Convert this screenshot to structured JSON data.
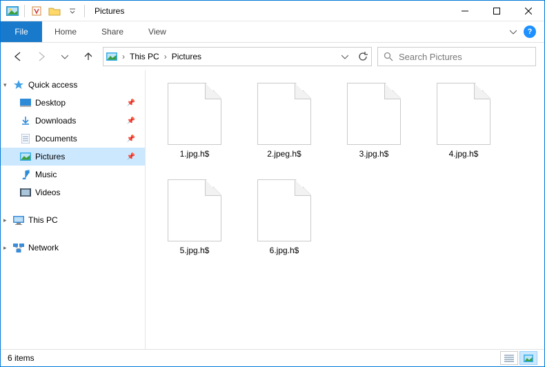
{
  "window": {
    "title": "Pictures"
  },
  "ribbon": {
    "file": "File",
    "tabs": [
      "Home",
      "Share",
      "View"
    ]
  },
  "breadcrumb": {
    "items": [
      "This PC",
      "Pictures"
    ]
  },
  "search": {
    "placeholder": "Search Pictures"
  },
  "sidebar": {
    "quickaccess": {
      "label": "Quick access",
      "items": [
        {
          "label": "Desktop",
          "pinned": true
        },
        {
          "label": "Downloads",
          "pinned": true
        },
        {
          "label": "Documents",
          "pinned": true
        },
        {
          "label": "Pictures",
          "pinned": true,
          "selected": true
        },
        {
          "label": "Music",
          "pinned": false
        },
        {
          "label": "Videos",
          "pinned": false
        }
      ]
    },
    "thispc": {
      "label": "This PC"
    },
    "network": {
      "label": "Network"
    }
  },
  "files": [
    {
      "name": "1.jpg.h$"
    },
    {
      "name": "2.jpeg.h$"
    },
    {
      "name": "3.jpg.h$"
    },
    {
      "name": "4.jpg.h$"
    },
    {
      "name": "5.jpg.h$"
    },
    {
      "name": "6.jpg.h$"
    }
  ],
  "status": {
    "count": "6 items"
  }
}
